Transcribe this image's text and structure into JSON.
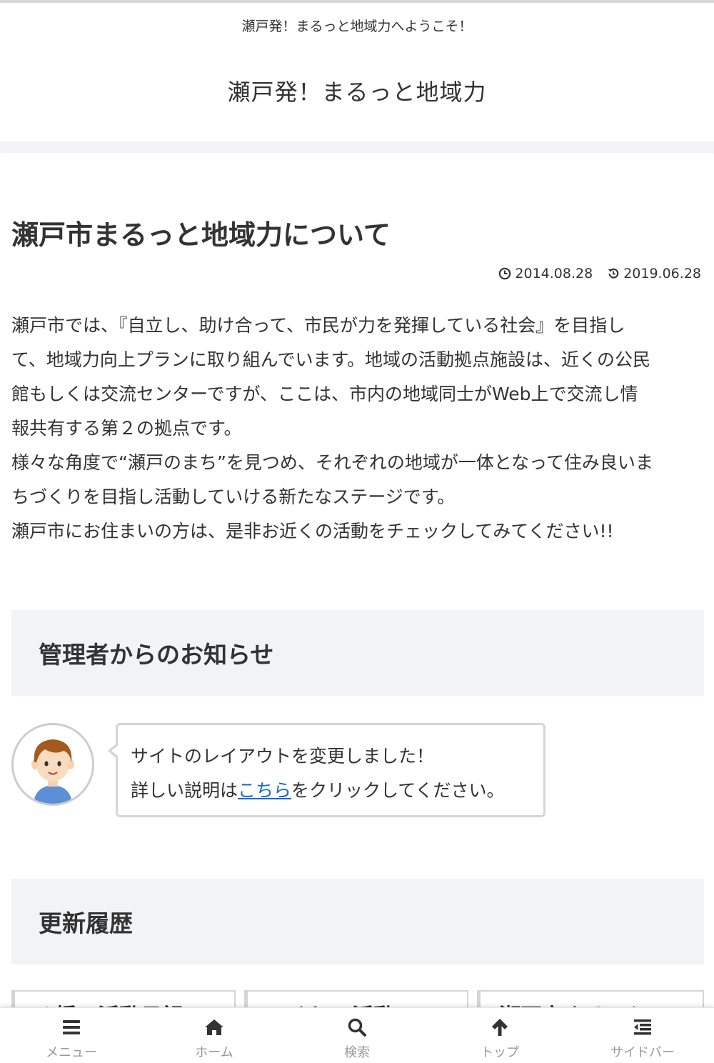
{
  "header": {
    "tagline": "瀬戸発！まるっと地域力へようこそ！",
    "site_name": "瀬戸発！まるっと地域力"
  },
  "article": {
    "title": "瀬戸市まるっと地域力について",
    "published": "2014.08.28",
    "updated": "2019.06.28",
    "paragraphs": [
      "瀬戸市では、『自立し、助け合って、市民が力を発揮している社会』を目指し",
      "て、地域力向上プランに取り組んでいます。地域の活動拠点施設は、近くの公民",
      "館もしくは交流センターですが、ここは、市内の地域同士がWeb上で交流し情",
      "報共有する第２の拠点です。",
      "様々な角度で“瀬戸のまち”を見つめ、それぞれの地域が一体となって住み良いま",
      "ちづくりを目指し活動していける新たなステージです。",
      "瀬戸市にお住まいの方は、是非お近くの活動をチェックしてみてください!!"
    ]
  },
  "notice": {
    "heading": "管理者からのお知らせ",
    "line1": "サイトのレイアウトを変更しました！",
    "line2_before": "詳しい説明は",
    "line2_link": "こちら",
    "line2_after": "をクリックしてください。"
  },
  "history": {
    "heading": "更新履歴",
    "cards": [
      "八幡の活動日記",
      "つくしの活動",
      "瀬戸市まるっと"
    ]
  },
  "bottom_nav": [
    {
      "label": "メニュー",
      "icon": "menu-icon"
    },
    {
      "label": "ホーム",
      "icon": "home-icon"
    },
    {
      "label": "検索",
      "icon": "search-icon"
    },
    {
      "label": "トップ",
      "icon": "arrow-up-icon"
    },
    {
      "label": "サイドバー",
      "icon": "sidebar-icon"
    }
  ],
  "colors": {
    "link": "#1967d2",
    "text": "#333333",
    "nav_label": "#999999",
    "section_bg": "#f2f3f5"
  }
}
